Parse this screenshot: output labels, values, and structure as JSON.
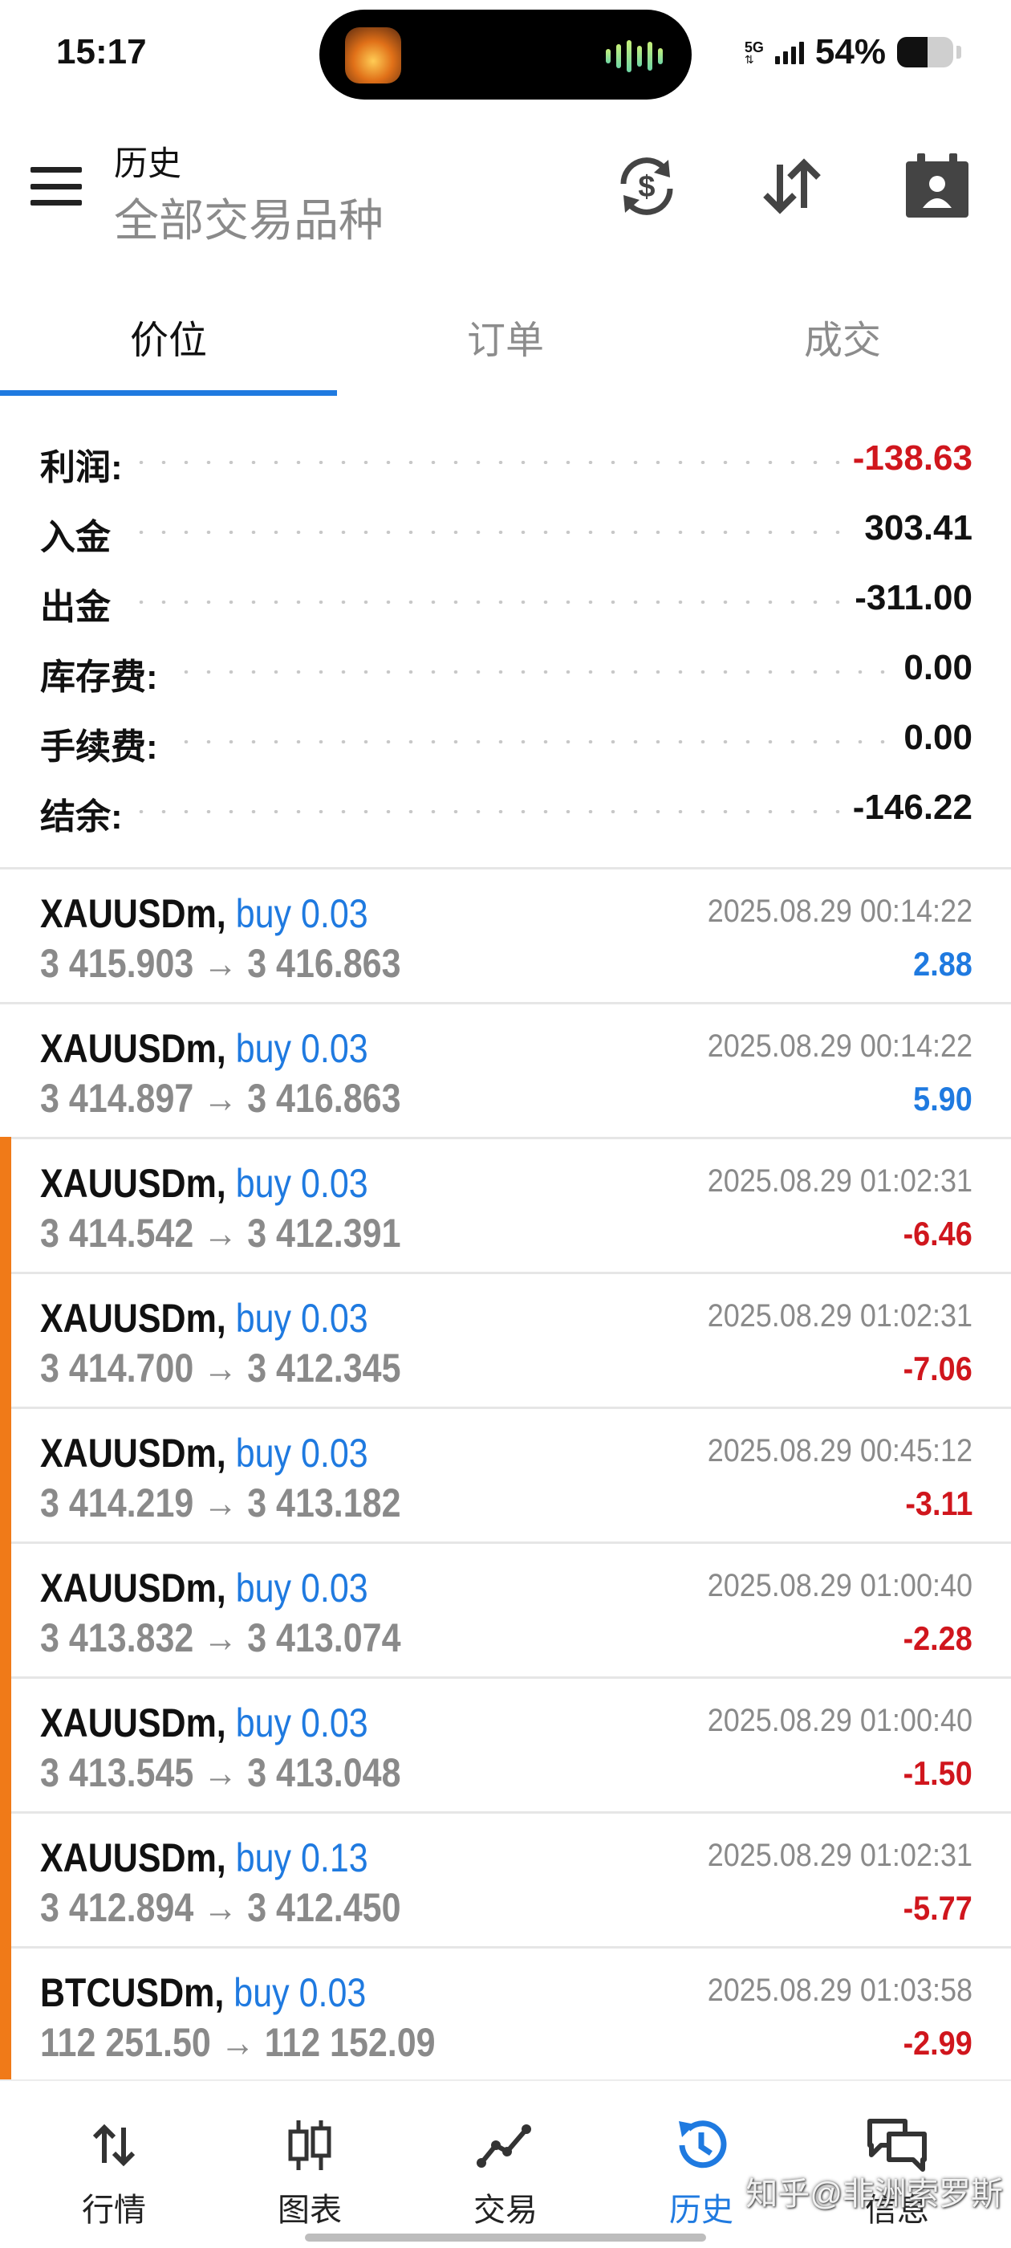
{
  "status_bar": {
    "time": "15:17",
    "network": "5G",
    "battery_text": "54%",
    "battery_level": 0.54
  },
  "header": {
    "title": "历史",
    "subtitle": "全部交易品种",
    "icons": [
      "menu-icon",
      "currency-exchange-icon",
      "sort-icon",
      "calendar-icon"
    ]
  },
  "tabs": [
    {
      "label": "价位",
      "active": true
    },
    {
      "label": "订单",
      "active": false
    },
    {
      "label": "成交",
      "active": false
    }
  ],
  "summary": [
    {
      "label": "利润:",
      "value": "-138.63",
      "negative": true
    },
    {
      "label": "入金",
      "value": "303.41",
      "negative": false
    },
    {
      "label": "出金",
      "value": "-311.00",
      "negative": false
    },
    {
      "label": "库存费:",
      "value": "0.00",
      "negative": false
    },
    {
      "label": "手续费:",
      "value": "0.00",
      "negative": false
    },
    {
      "label": "结余:",
      "value": "-146.22",
      "negative": false
    }
  ],
  "deals": [
    {
      "symbol": "XAUUSDm,",
      "side": "buy 0.03",
      "prices": "3 415.903 → 3 416.863",
      "time": "2025.08.29 00:14:22",
      "profit": "2.88",
      "positive": true,
      "flag": false
    },
    {
      "symbol": "XAUUSDm,",
      "side": "buy 0.03",
      "prices": "3 414.897 → 3 416.863",
      "time": "2025.08.29 00:14:22",
      "profit": "5.90",
      "positive": true,
      "flag": false
    },
    {
      "symbol": "XAUUSDm,",
      "side": "buy 0.03",
      "prices": "3 414.542 → 3 412.391",
      "time": "2025.08.29 01:02:31",
      "profit": "-6.46",
      "positive": false,
      "flag": true
    },
    {
      "symbol": "XAUUSDm,",
      "side": "buy 0.03",
      "prices": "3 414.700 → 3 412.345",
      "time": "2025.08.29 01:02:31",
      "profit": "-7.06",
      "positive": false,
      "flag": true
    },
    {
      "symbol": "XAUUSDm,",
      "side": "buy 0.03",
      "prices": "3 414.219 → 3 413.182",
      "time": "2025.08.29 00:45:12",
      "profit": "-3.11",
      "positive": false,
      "flag": true
    },
    {
      "symbol": "XAUUSDm,",
      "side": "buy 0.03",
      "prices": "3 413.832 → 3 413.074",
      "time": "2025.08.29 01:00:40",
      "profit": "-2.28",
      "positive": false,
      "flag": true
    },
    {
      "symbol": "XAUUSDm,",
      "side": "buy 0.03",
      "prices": "3 413.545 → 3 413.048",
      "time": "2025.08.29 01:00:40",
      "profit": "-1.50",
      "positive": false,
      "flag": true
    },
    {
      "symbol": "XAUUSDm,",
      "side": "buy 0.13",
      "prices": "3 412.894 → 3 412.450",
      "time": "2025.08.29 01:02:31",
      "profit": "-5.77",
      "positive": false,
      "flag": true
    },
    {
      "symbol": "BTCUSDm,",
      "side": "buy 0.03",
      "prices": "112 251.50 → 112 152.09",
      "time": "2025.08.29 01:03:58",
      "profit": "-2.99",
      "positive": false,
      "flag": true
    }
  ],
  "bottom_nav": [
    {
      "label": "行情",
      "icon": "quotes-arrows-icon",
      "active": false
    },
    {
      "label": "图表",
      "icon": "candlestick-chart-icon",
      "active": false
    },
    {
      "label": "交易",
      "icon": "trade-line-icon",
      "active": false
    },
    {
      "label": "历史",
      "icon": "history-clock-icon",
      "active": true
    },
    {
      "label": "信息",
      "icon": "messages-icon",
      "active": false
    }
  ],
  "watermark": "知乎@非洲索罗斯",
  "colors": {
    "accent": "#1f7ae0",
    "negative": "#d0161d",
    "flag": "#f07a18"
  }
}
